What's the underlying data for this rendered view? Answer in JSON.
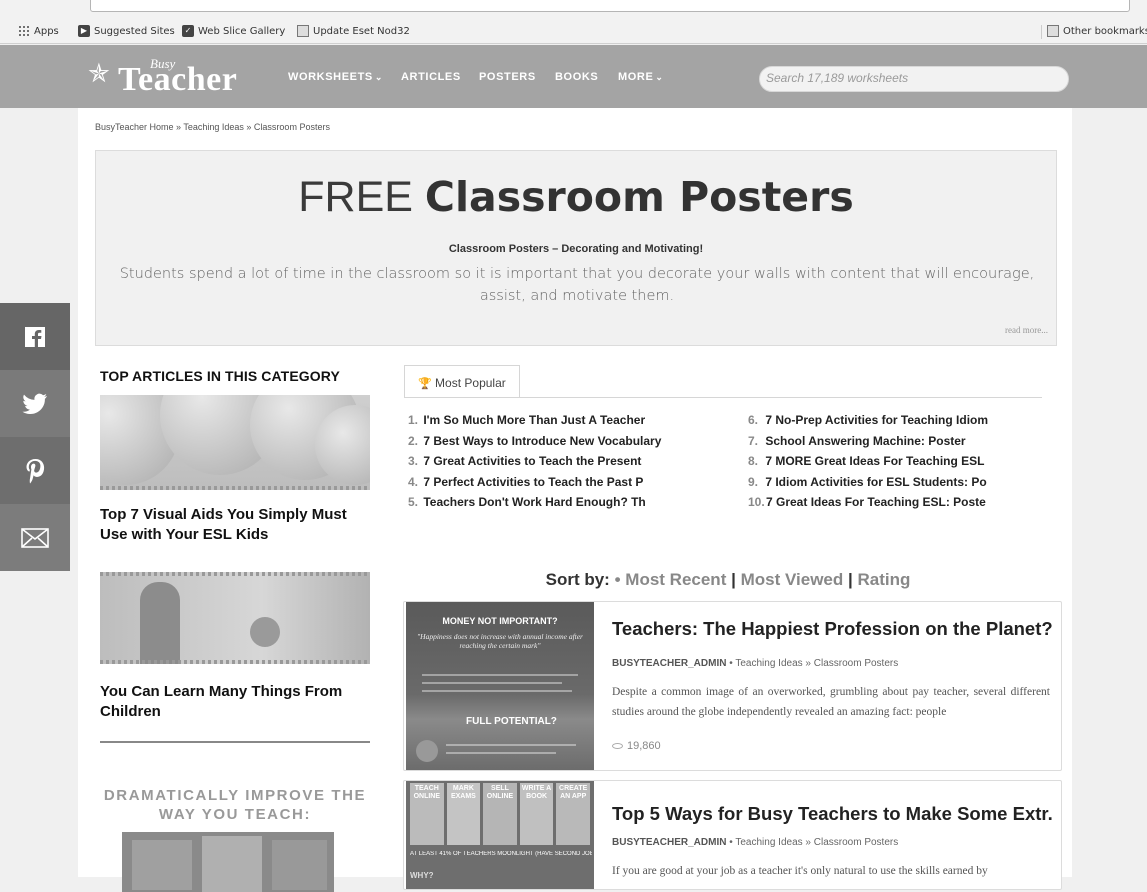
{
  "bookmarks": {
    "apps": "Apps",
    "suggested": "Suggested Sites",
    "webslice": "Web Slice Gallery",
    "eset": "Update Eset Nod32",
    "other": "Other bookmarks"
  },
  "header": {
    "logo_busy": "Busy",
    "logo_teacher": "Teacher",
    "nav": [
      "WORKSHEETS",
      "ARTICLES",
      "POSTERS",
      "BOOKS",
      "MORE"
    ],
    "search_placeholder": "Search 17,189 worksheets"
  },
  "breadcrumb": "BusyTeacher Home » Teaching Ideas » Classroom Posters",
  "hero": {
    "title_light": "FREE ",
    "title_bold": "Classroom Posters",
    "subtitle": "Classroom Posters – Decorating and Motivating!",
    "description": "Students spend a lot of time in the classroom so it is important that you decorate your walls with content that will encourage, assist, and motivate them.",
    "read_more": "read more..."
  },
  "left": {
    "heading": "TOP ARTICLES IN THIS CATEGORY",
    "articles": [
      "Top 7 Visual Aids You Simply Must Use with Your ESL Kids",
      "You Can Learn Many Things From Children"
    ],
    "promo": "DRAMATICALLY IMPROVE THE WAY YOU TEACH:"
  },
  "popular": {
    "tab": "Most Popular",
    "items": [
      {
        "n": "1.",
        "t": "I'm So Much More Than Just A Teacher"
      },
      {
        "n": "2.",
        "t": "7 Best Ways to Introduce New Vocabulary"
      },
      {
        "n": "3.",
        "t": "7 Great Activities to Teach the Present"
      },
      {
        "n": "4.",
        "t": "7 Perfect Activities to Teach the Past P"
      },
      {
        "n": "5.",
        "t": "Teachers Don't Work Hard Enough? Th"
      },
      {
        "n": "6.",
        "t": "7 No-Prep Activities for Teaching Idiom"
      },
      {
        "n": "7.",
        "t": "School Answering Machine: Poster"
      },
      {
        "n": "8.",
        "t": "7 MORE Great Ideas For Teaching ESL"
      },
      {
        "n": "9.",
        "t": "7 Idiom Activities for ESL Students: Po"
      },
      {
        "n": "10.",
        "t": "7 Great Ideas For Teaching ESL: Poste"
      }
    ]
  },
  "sort": {
    "label": "Sort by:",
    "recent": "Most Recent",
    "viewed": "Most Viewed",
    "rating": "Rating",
    "sep": "|"
  },
  "posts": [
    {
      "title": "Teachers: The Happiest Profession on the Planet?...",
      "user": "BUSYTEACHER_admin",
      "dot": "•",
      "cat": "Teaching Ideas » Classroom Posters",
      "desc": "Despite a common image of an overworked, grumbling about pay teacher, several different studies around the globe independently revealed an amazing fact: people",
      "views": "19,860",
      "img_text1": "MONEY NOT IMPORTANT?",
      "img_text2": "\"Happiness does not increase with annual income after reaching the certain mark\"",
      "img_text3": "FULL POTENTIAL?"
    },
    {
      "title": "Top 5 Ways for Busy Teachers to Make Some Extr...",
      "user": "BUSYTEACHER_admin",
      "dot": "•",
      "cat": "Teaching Ideas » Classroom Posters",
      "desc": "If you are good at your job as a teacher it's only natural to use the skills earned by",
      "img_tabs": [
        "TEACH ONLINE",
        "MARK EXAMS",
        "SELL ONLINE",
        "WRITE A BOOK",
        "CREATE AN APP"
      ],
      "img_text1": "AT LEAST 41% OF TEACHERS MOONLIGHT (HAVE SECOND JOBS)",
      "img_text2": "WHY?"
    }
  ]
}
